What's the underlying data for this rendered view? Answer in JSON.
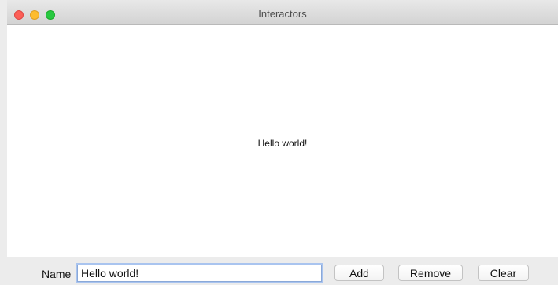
{
  "window": {
    "title": "Interactors"
  },
  "canvas": {
    "text": "Hello world!"
  },
  "controls": {
    "name_label": "Name",
    "name_value": "Hello world!",
    "add_label": "Add",
    "remove_label": "Remove",
    "clear_label": "Clear"
  }
}
